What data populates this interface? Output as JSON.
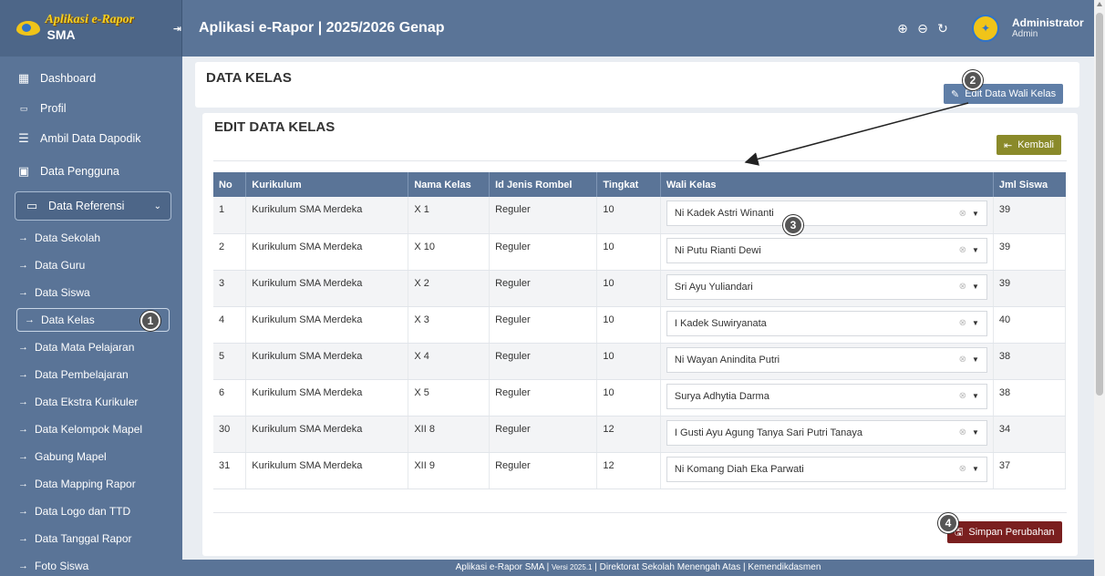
{
  "brand": {
    "logo_text": "Aplikasi e-Rapor",
    "logo_suffix": "SMA",
    "pin_icon": "pin-icon"
  },
  "header": {
    "title": "Aplikasi e-Rapor | 2025/2026 Genap",
    "user_name": "Administrator",
    "user_role": "Admin"
  },
  "sidebar": {
    "items": [
      {
        "label": "Dashboard",
        "icon": "dashboard-icon"
      },
      {
        "label": "Profil",
        "icon": "id-card-icon"
      },
      {
        "label": "Ambil Data Dapodik",
        "icon": "database-icon"
      },
      {
        "label": "Data Pengguna",
        "icon": "users-icon"
      }
    ],
    "group": {
      "label": "Data Referensi",
      "icon": "monitor-icon"
    },
    "sub_items": [
      "Data Sekolah",
      "Data Guru",
      "Data Siswa",
      "Data Kelas",
      "Data Mata Pelajaran",
      "Data Pembelajaran",
      "Data Ekstra Kurikuler",
      "Data Kelompok Mapel",
      "Gabung Mapel",
      "Data Mapping Rapor",
      "Data Logo dan TTD",
      "Data Tanggal Rapor",
      "Foto Siswa"
    ],
    "active_sub": "Data Kelas"
  },
  "page": {
    "title": "DATA KELAS",
    "edit_wali_button": "Edit Data Wali Kelas",
    "card_title": "EDIT DATA KELAS",
    "kembali_button": "Kembali",
    "simpan_button": "Simpan Perubahan"
  },
  "table": {
    "headers": [
      "No",
      "Kurikulum",
      "Nama Kelas",
      "Id Jenis Rombel",
      "Tingkat",
      "Wali Kelas",
      "Jml Siswa"
    ],
    "rows": [
      {
        "no": "1",
        "kurikulum": "Kurikulum SMA Merdeka",
        "nama": "X 1",
        "jenis": "Reguler",
        "tingkat": "10",
        "wali": "Ni Kadek Astri Winanti",
        "jml": "39"
      },
      {
        "no": "2",
        "kurikulum": "Kurikulum SMA Merdeka",
        "nama": "X 10",
        "jenis": "Reguler",
        "tingkat": "10",
        "wali": "Ni Putu Rianti Dewi",
        "jml": "39"
      },
      {
        "no": "3",
        "kurikulum": "Kurikulum SMA Merdeka",
        "nama": "X 2",
        "jenis": "Reguler",
        "tingkat": "10",
        "wali": "Sri Ayu Yuliandari",
        "jml": "39"
      },
      {
        "no": "4",
        "kurikulum": "Kurikulum SMA Merdeka",
        "nama": "X 3",
        "jenis": "Reguler",
        "tingkat": "10",
        "wali": "I Kadek Suwiryanata",
        "jml": "40"
      },
      {
        "no": "5",
        "kurikulum": "Kurikulum SMA Merdeka",
        "nama": "X 4",
        "jenis": "Reguler",
        "tingkat": "10",
        "wali": "Ni Wayan Anindita Putri",
        "jml": "38"
      },
      {
        "no": "6",
        "kurikulum": "Kurikulum SMA Merdeka",
        "nama": "X 5",
        "jenis": "Reguler",
        "tingkat": "10",
        "wali": "Surya Adhytia Darma",
        "jml": "38"
      },
      {
        "no": "30",
        "kurikulum": "Kurikulum SMA Merdeka",
        "nama": "XII 8",
        "jenis": "Reguler",
        "tingkat": "12",
        "wali": "I Gusti Ayu Agung Tanya Sari Putri Tanaya",
        "jml": "34"
      },
      {
        "no": "31",
        "kurikulum": "Kurikulum SMA Merdeka",
        "nama": "XII 9",
        "jenis": "Reguler",
        "tingkat": "12",
        "wali": "Ni Komang Diah Eka Parwati",
        "jml": "37"
      }
    ]
  },
  "badges": [
    "1",
    "2",
    "3",
    "4"
  ],
  "footer": {
    "text_left": "Aplikasi e-Rapor SMA | ",
    "version": "Versi 2025.1",
    "text_right": " | Direktorat Sekolah Menengah Atas | Kemendikdasmen"
  },
  "colors": {
    "primary": "#5a7497",
    "kembali": "#8a8a2a",
    "simpan": "#7a1f1f"
  }
}
